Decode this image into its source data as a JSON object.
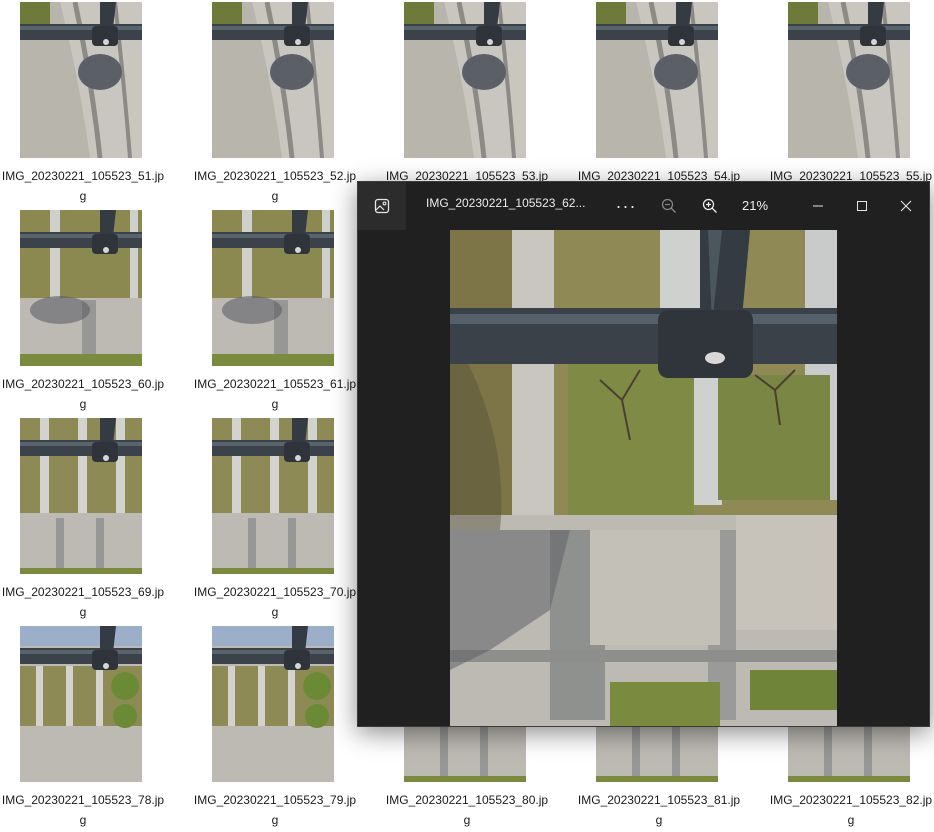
{
  "files": [
    {
      "name": "IMG_20230221_105523_51.jpg",
      "kind": "curve"
    },
    {
      "name": "IMG_20230221_105523_52.jpg",
      "kind": "curve"
    },
    {
      "name": "IMG_20230221_105523_53.jpg",
      "kind": "curve"
    },
    {
      "name": "IMG_20230221_105523_54.jpg",
      "kind": "curve"
    },
    {
      "name": "IMG_20230221_105523_55.jpg",
      "kind": "curve"
    },
    {
      "name": "IMG_20230221_105523_60.jpg",
      "kind": "lawn"
    },
    {
      "name": "IMG_20230221_105523_61.jpg",
      "kind": "lawn"
    },
    {
      "name": "IMG_20230221_105523_69.jpg",
      "kind": "strips"
    },
    {
      "name": "IMG_20230221_105523_70.jpg",
      "kind": "strips"
    },
    {
      "name": "IMG_20230221_105523_78.jpg",
      "kind": "shrubs"
    },
    {
      "name": "IMG_20230221_105523_79.jpg",
      "kind": "shrubs"
    },
    {
      "name": "IMG_20230221_105523_80.jpg",
      "kind": "strips"
    },
    {
      "name": "IMG_20230221_105523_81.jpg",
      "kind": "strips"
    },
    {
      "name": "IMG_20230221_105523_82.jpg",
      "kind": "strips"
    }
  ],
  "viewer": {
    "title": "IMG_20230221_105523_62...",
    "more_label": "···",
    "zoom_level": "21%",
    "icons": {
      "app": "image-icon",
      "zoom_out": "zoom-out-icon",
      "zoom_in": "zoom-in-icon",
      "minimize": "minimize-icon",
      "maximize": "maximize-icon",
      "close": "close-icon"
    }
  },
  "colors": {
    "viewer_bg": "#202020",
    "rail": "#3a4148",
    "grass": "#8a8a4a",
    "paving": "#b9b6ae"
  }
}
